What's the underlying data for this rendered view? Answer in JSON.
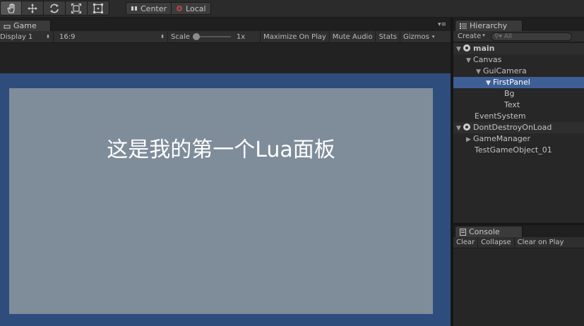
{
  "toolbar": {
    "tools": [
      {
        "name": "hand-tool",
        "icon": "hand-icon",
        "active": true
      },
      {
        "name": "move-tool",
        "icon": "move-arrows-icon",
        "active": false
      },
      {
        "name": "rotate-tool",
        "icon": "rotate-icon",
        "active": false
      },
      {
        "name": "scale-tool",
        "icon": "scale-icon",
        "active": false
      },
      {
        "name": "rect-tool",
        "icon": "rect-icon",
        "active": false
      }
    ],
    "pivot_label": "Center",
    "space_label": "Local"
  },
  "game": {
    "tab_label": "Game",
    "display": "Display 1",
    "aspect": "16:9",
    "scale_label": "Scale",
    "scale_value": "1x",
    "maximize_label": "Maximize On Play",
    "mute_label": "Mute Audio",
    "stats_label": "Stats",
    "gizmos_label": "Gizmos",
    "panel_text": "这是我的第一个Lua面板",
    "colors": {
      "canvas_bg": "#2f4d7c",
      "panel_bg": "#7f8c9a"
    }
  },
  "hierarchy": {
    "tab_label": "Hierarchy",
    "create_label": "Create",
    "search_placeholder": "All",
    "items": [
      {
        "label": "main",
        "type": "scene"
      },
      {
        "label": "Canvas",
        "type": "object"
      },
      {
        "label": "GuiCamera",
        "type": "object"
      },
      {
        "label": "FirstPanel",
        "type": "object",
        "selected": true
      },
      {
        "label": "Bg",
        "type": "object"
      },
      {
        "label": "Text",
        "type": "object"
      },
      {
        "label": "EventSystem",
        "type": "object"
      },
      {
        "label": "DontDestroyOnLoad",
        "type": "scene"
      },
      {
        "label": "GameManager",
        "type": "object"
      },
      {
        "label": "TestGameObject_01",
        "type": "object"
      }
    ]
  },
  "console": {
    "tab_label": "Console",
    "clear_label": "Clear",
    "collapse_label": "Collapse",
    "clear_on_play_label": "Clear on Play"
  }
}
